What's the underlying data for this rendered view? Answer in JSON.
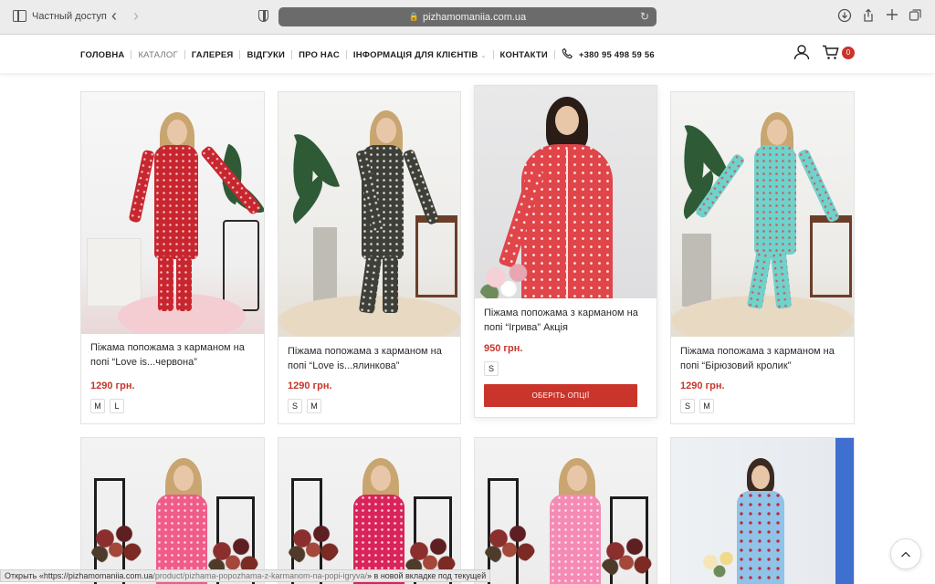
{
  "browser": {
    "private_label": "Частный доступ",
    "url": "pizhamomaniia.com.ua"
  },
  "nav": {
    "items": [
      "ГОЛОВНА",
      "КАТАЛОГ",
      "ГАЛЕРЕЯ",
      "ВІДГУКИ",
      "ПРО НАС",
      "ІНФОРМАЦІЯ ДЛЯ КЛІЄНТІВ",
      "КОНТАКТИ"
    ],
    "phone": "+380 95 498 59 56",
    "cart_count": "0"
  },
  "products": [
    {
      "title": "Піжама попожама з карманом на попі “Love is...червона”",
      "price": "1290 грн.",
      "sizes": [
        "M",
        "L"
      ],
      "color": "#c8262f"
    },
    {
      "title": "Піжама попожама з карманом на попі “Love is...ялинкова”",
      "price": "1290 грн.",
      "sizes": [
        "S",
        "M"
      ],
      "color": "#3e3f38"
    },
    {
      "title": "Піжама попожама з карманом на попі “Ігрива” Акція",
      "price": "950 грн.",
      "sizes": [
        "S"
      ],
      "button": "ОБЕРІТЬ ОПЦІЇ",
      "color": "#e0454a"
    },
    {
      "title": "Піжама попожама з карманом на попі “Бірюзовий кролик”",
      "price": "1290 грн.",
      "sizes": [
        "S",
        "M"
      ],
      "color": "#6fd3cb"
    }
  ],
  "status_bar": {
    "prefix": "Открыть «",
    "host": "https://pizhamomaniia.com.ua",
    "path": "/product/pizhama-popozhama-z-karmanom-na-popi-igryva/",
    "suffix": "» в новой вкладке под текущей"
  },
  "colors": {
    "accent": "#c9342b"
  }
}
